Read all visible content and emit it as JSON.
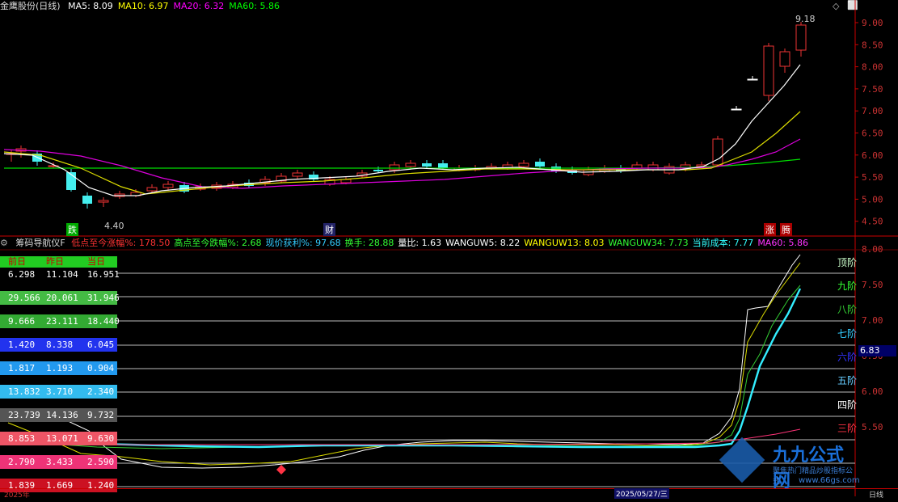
{
  "top": {
    "title": "金鹰股份(日线)",
    "ma": [
      {
        "label": "MA5: 8.09",
        "color": "#ffffff"
      },
      {
        "label": "MA10: 6.97",
        "color": "#ffff00"
      },
      {
        "label": "MA20: 6.32",
        "color": "#ff00ff"
      },
      {
        "label": "MA60: 5.86",
        "color": "#00ff00"
      }
    ],
    "price_axis": [
      "9.00",
      "8.50",
      "8.00",
      "7.50",
      "7.00",
      "6.50",
      "6.00",
      "5.50",
      "5.00",
      "4.50"
    ],
    "low_marker": "4.40",
    "high_marker": "9.18",
    "markers": {
      "die": "跌",
      "cai": "财",
      "zhang": "涨",
      "teng": "腾"
    },
    "corner_icons": [
      "◇",
      "⬜"
    ]
  },
  "bottom": {
    "indicator_name": "筹码导航仪F",
    "stats": [
      {
        "label": "低点至今涨幅%: 178.50",
        "color": "#ff3333"
      },
      {
        "label": "高点至今跌幅%: 2.68",
        "color": "#33ff33"
      },
      {
        "label": "现价获利%: 97.68",
        "color": "#33ccff"
      },
      {
        "label": "换手: 28.88",
        "color": "#33ff33"
      },
      {
        "label": "量比: 1.63",
        "color": "#ffffff"
      },
      {
        "label": "WANGUW5: 8.22",
        "color": "#ffffff"
      },
      {
        "label": "WANGUW13: 8.03",
        "color": "#ffff00"
      },
      {
        "label": "WANGUW34: 7.73",
        "color": "#33ff33"
      },
      {
        "label": "当前成本: 7.77",
        "color": "#33ffff"
      },
      {
        "label": "MA60: 5.86",
        "color": "#ff33ff"
      }
    ],
    "table_header": [
      "前日",
      "昨日",
      "当日"
    ],
    "table_rows": [
      {
        "values": [
          "6.298",
          "11.104",
          "16.951"
        ],
        "bg": "#000000",
        "fg": "#ffffff"
      },
      {
        "values": [
          "29.566",
          "20.061",
          "31.946"
        ],
        "bg": "#44bb44",
        "fg": "#ffffff"
      },
      {
        "values": [
          "9.666",
          "23.111",
          "18.440"
        ],
        "bg": "#33aa33",
        "fg": "#ffffff"
      },
      {
        "values": [
          "1.420",
          "8.338",
          "6.045"
        ],
        "bg": "#2233ee",
        "fg": "#ffffff"
      },
      {
        "values": [
          "1.817",
          "1.193",
          "0.904"
        ],
        "bg": "#2299ee",
        "fg": "#ffffff"
      },
      {
        "values": [
          "13.832",
          "3.710",
          "2.340"
        ],
        "bg": "#33bbee",
        "fg": "#ffffff"
      },
      {
        "values": [
          "23.739",
          "14.136",
          "9.732"
        ],
        "bg": "#555555",
        "fg": "#ffffff"
      },
      {
        "values": [
          "8.853",
          "13.071",
          "9.630"
        ],
        "bg": "#ee5566",
        "fg": "#ffffff"
      },
      {
        "values": [
          "2.790",
          "3.433",
          "2.590"
        ],
        "bg": "#ee3377",
        "fg": "#ffffff"
      },
      {
        "values": [
          "1.839",
          "1.669",
          "1.240"
        ],
        "bg": "#cc1122",
        "fg": "#ffffff"
      }
    ],
    "stages": [
      {
        "label": "顶阶",
        "color": "#ccffcc"
      },
      {
        "label": "九阶",
        "color": "#33ff33"
      },
      {
        "label": "八阶",
        "color": "#33cc33"
      },
      {
        "label": "七阶",
        "color": "#33ccff"
      },
      {
        "label": "六阶",
        "color": "#3333ff"
      },
      {
        "label": "五阶",
        "color": "#66ccff"
      },
      {
        "label": "四阶",
        "color": "#ffffff"
      },
      {
        "label": "三阶",
        "color": "#ff3344"
      }
    ],
    "price_axis": [
      "8.00",
      "7.50",
      "7.00",
      "6.50",
      "6.00",
      "5.50"
    ],
    "price_tag": "6.83",
    "bottom_date": "2025/05/27/三",
    "bottom_left": "2025年",
    "bottom_right": "日线"
  },
  "watermark": {
    "brand": "九九公式网",
    "sub": "聚焦热门精品炒股指标公式",
    "url": "www.66gs.com"
  }
}
